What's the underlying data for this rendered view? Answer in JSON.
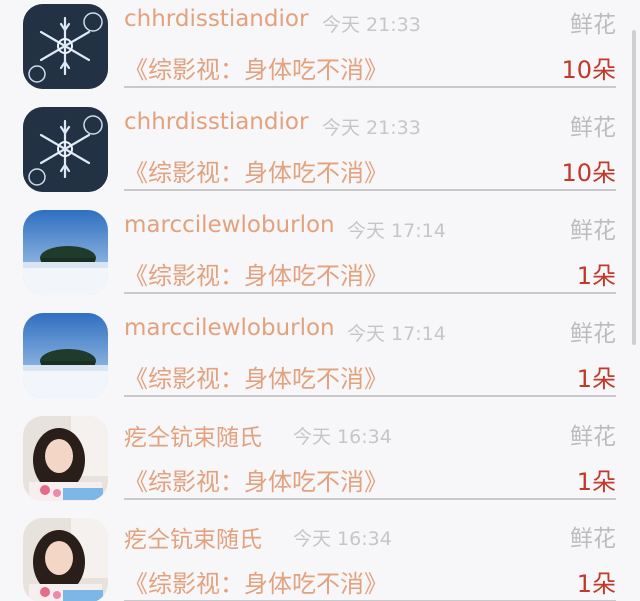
{
  "rows": [
    {
      "username": "chhrdisstiandior",
      "time": "今天 21:33",
      "gift_type": "鲜花",
      "title": "《综影视：身体吃不消》",
      "count": "10朵",
      "avatar": "snowflake-avatar"
    },
    {
      "username": "chhrdisstiandior",
      "time": "今天 21:33",
      "gift_type": "鲜花",
      "title": "《综影视：身体吃不消》",
      "count": "10朵",
      "avatar": "snowflake-avatar"
    },
    {
      "username": "marccilewloburlon",
      "time": "今天 17:14",
      "gift_type": "鲜花",
      "title": "《综影视：身体吃不消》",
      "count": "1朵",
      "avatar": "snowy-trees-avatar"
    },
    {
      "username": "marccilewloburlon",
      "time": "今天 17:14",
      "gift_type": "鲜花",
      "title": "《综影视：身体吃不消》",
      "count": "1朵",
      "avatar": "snowy-trees-avatar"
    },
    {
      "username": "疙仝钪束随氏",
      "time": "今天 16:34",
      "gift_type": "鲜花",
      "title": "《综影视：身体吃不消》",
      "count": "1朵",
      "avatar": "girl-photo-avatar"
    },
    {
      "username": "疙仝钪束随氏",
      "time": "今天 16:34",
      "gift_type": "鲜花",
      "title": "《综影视：身体吃不消》",
      "count": "1朵",
      "avatar": "girl-photo-avatar"
    }
  ],
  "colors": {
    "accent_text": "#e2a27e",
    "count_red": "#c0392b",
    "muted": "#bcbcbe",
    "background": "#f7f6f8"
  }
}
